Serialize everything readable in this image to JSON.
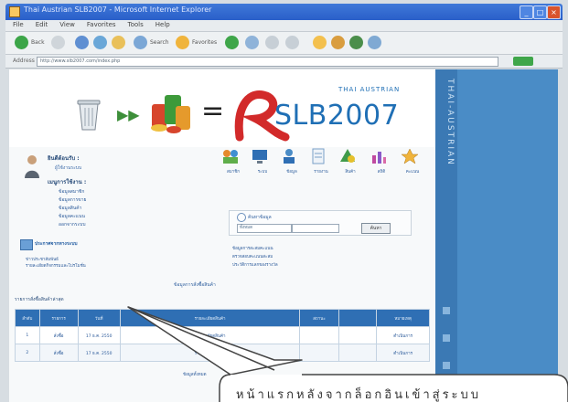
{
  "window": {
    "title": "Thai Austrian SLB2007 - Microsoft Internet Explorer",
    "menu": [
      "File",
      "Edit",
      "View",
      "Favorites",
      "Tools",
      "Help"
    ]
  },
  "toolbar": {
    "back_label": "Back",
    "search_label": "Search",
    "favorites_label": "Favorites"
  },
  "address": {
    "label": "Address",
    "value": "http://www.slb2007.com/index.php"
  },
  "header": {
    "logo_text": "SLB2007",
    "logo_sub": "THAI AUSTRIAN"
  },
  "sidebar": {
    "rail_text": "THAI-AUSTRIAN"
  },
  "info": {
    "welcome": "ยินดีต้อนรับ :",
    "user": "ผู้ใช้งานระบบ",
    "menu_title": "เมนูการใช้งาน :",
    "items": [
      "ข้อมูลสมาชิก",
      "ข้อมูลการขาย",
      "ข้อมูลสินค้า",
      "ข้อมูลคะแนน",
      "ออกจากระบบ"
    ]
  },
  "icons": [
    {
      "name": "members-icon",
      "label": "สมาชิก"
    },
    {
      "name": "monitor-icon",
      "label": "ระบบ"
    },
    {
      "name": "people-icon",
      "label": "ข้อมูล"
    },
    {
      "name": "document-icon",
      "label": "รายงาน"
    },
    {
      "name": "shapes-icon",
      "label": "สินค้า"
    },
    {
      "name": "chart-icon",
      "label": "สถิติ"
    },
    {
      "name": "star-icon",
      "label": "คะแนน"
    }
  ],
  "search": {
    "title": "ค้นหาข้อมูล",
    "select_value": "ทั้งหมด",
    "button": "ค้นหา"
  },
  "links": [
    "ข้อมูลการสะสมคะแนน",
    "ตรวจสอบคะแนนสะสม",
    "ประวัติการแลกของรางวัล"
  ],
  "notice": {
    "title": "ประกาศจากทางระบบ",
    "line1": "ข่าวประชาสัมพันธ์",
    "line2": "รายละเอียดกิจกรรมและโปรโมชั่น"
  },
  "center_line": "ข้อมูลการสั่งซื้อสินค้า",
  "table": {
    "title": "รายการสั่งซื้อสินค้าล่าสุด",
    "headers": [
      "ลำดับ",
      "รายการ",
      "วันที่",
      "รายละเอียดสินค้า",
      "สถานะ",
      "",
      "หมายเหตุ"
    ],
    "rows": [
      [
        "1",
        "สั่งซื้อ",
        "17 ธ.ค. 2550",
        "รายละเอียดสินค้า",
        "",
        "",
        "ดำเนินการ"
      ],
      [
        "2",
        "สั่งซื้อ",
        "17 ธ.ค. 2550",
        "รายละเอียดสินค้า",
        "",
        "",
        "ดำเนินการ"
      ]
    ]
  },
  "bottom_note": "ข้อมูลทั้งหมด",
  "callout": {
    "text": "หน้าแรกหลังจากล็อกอินเข้าสู่ระบบ"
  }
}
